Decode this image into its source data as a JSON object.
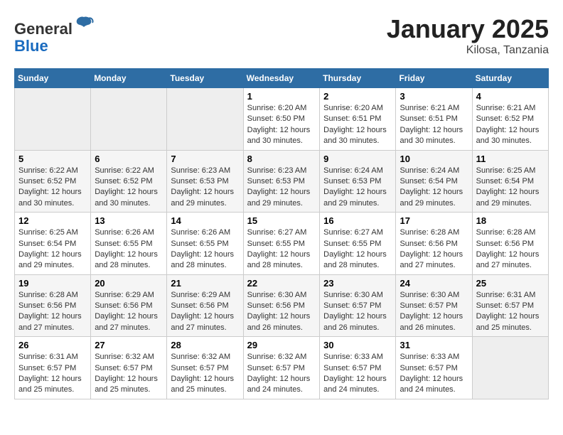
{
  "header": {
    "logo_general": "General",
    "logo_blue": "Blue",
    "month_title": "January 2025",
    "location": "Kilosa, Tanzania"
  },
  "days_of_week": [
    "Sunday",
    "Monday",
    "Tuesday",
    "Wednesday",
    "Thursday",
    "Friday",
    "Saturday"
  ],
  "weeks": [
    [
      {
        "num": "",
        "info": ""
      },
      {
        "num": "",
        "info": ""
      },
      {
        "num": "",
        "info": ""
      },
      {
        "num": "1",
        "info": "Sunrise: 6:20 AM\nSunset: 6:50 PM\nDaylight: 12 hours\nand 30 minutes."
      },
      {
        "num": "2",
        "info": "Sunrise: 6:20 AM\nSunset: 6:51 PM\nDaylight: 12 hours\nand 30 minutes."
      },
      {
        "num": "3",
        "info": "Sunrise: 6:21 AM\nSunset: 6:51 PM\nDaylight: 12 hours\nand 30 minutes."
      },
      {
        "num": "4",
        "info": "Sunrise: 6:21 AM\nSunset: 6:52 PM\nDaylight: 12 hours\nand 30 minutes."
      }
    ],
    [
      {
        "num": "5",
        "info": "Sunrise: 6:22 AM\nSunset: 6:52 PM\nDaylight: 12 hours\nand 30 minutes."
      },
      {
        "num": "6",
        "info": "Sunrise: 6:22 AM\nSunset: 6:52 PM\nDaylight: 12 hours\nand 30 minutes."
      },
      {
        "num": "7",
        "info": "Sunrise: 6:23 AM\nSunset: 6:53 PM\nDaylight: 12 hours\nand 29 minutes."
      },
      {
        "num": "8",
        "info": "Sunrise: 6:23 AM\nSunset: 6:53 PM\nDaylight: 12 hours\nand 29 minutes."
      },
      {
        "num": "9",
        "info": "Sunrise: 6:24 AM\nSunset: 6:53 PM\nDaylight: 12 hours\nand 29 minutes."
      },
      {
        "num": "10",
        "info": "Sunrise: 6:24 AM\nSunset: 6:54 PM\nDaylight: 12 hours\nand 29 minutes."
      },
      {
        "num": "11",
        "info": "Sunrise: 6:25 AM\nSunset: 6:54 PM\nDaylight: 12 hours\nand 29 minutes."
      }
    ],
    [
      {
        "num": "12",
        "info": "Sunrise: 6:25 AM\nSunset: 6:54 PM\nDaylight: 12 hours\nand 29 minutes."
      },
      {
        "num": "13",
        "info": "Sunrise: 6:26 AM\nSunset: 6:55 PM\nDaylight: 12 hours\nand 28 minutes."
      },
      {
        "num": "14",
        "info": "Sunrise: 6:26 AM\nSunset: 6:55 PM\nDaylight: 12 hours\nand 28 minutes."
      },
      {
        "num": "15",
        "info": "Sunrise: 6:27 AM\nSunset: 6:55 PM\nDaylight: 12 hours\nand 28 minutes."
      },
      {
        "num": "16",
        "info": "Sunrise: 6:27 AM\nSunset: 6:55 PM\nDaylight: 12 hours\nand 28 minutes."
      },
      {
        "num": "17",
        "info": "Sunrise: 6:28 AM\nSunset: 6:56 PM\nDaylight: 12 hours\nand 27 minutes."
      },
      {
        "num": "18",
        "info": "Sunrise: 6:28 AM\nSunset: 6:56 PM\nDaylight: 12 hours\nand 27 minutes."
      }
    ],
    [
      {
        "num": "19",
        "info": "Sunrise: 6:28 AM\nSunset: 6:56 PM\nDaylight: 12 hours\nand 27 minutes."
      },
      {
        "num": "20",
        "info": "Sunrise: 6:29 AM\nSunset: 6:56 PM\nDaylight: 12 hours\nand 27 minutes."
      },
      {
        "num": "21",
        "info": "Sunrise: 6:29 AM\nSunset: 6:56 PM\nDaylight: 12 hours\nand 27 minutes."
      },
      {
        "num": "22",
        "info": "Sunrise: 6:30 AM\nSunset: 6:56 PM\nDaylight: 12 hours\nand 26 minutes."
      },
      {
        "num": "23",
        "info": "Sunrise: 6:30 AM\nSunset: 6:57 PM\nDaylight: 12 hours\nand 26 minutes."
      },
      {
        "num": "24",
        "info": "Sunrise: 6:30 AM\nSunset: 6:57 PM\nDaylight: 12 hours\nand 26 minutes."
      },
      {
        "num": "25",
        "info": "Sunrise: 6:31 AM\nSunset: 6:57 PM\nDaylight: 12 hours\nand 25 minutes."
      }
    ],
    [
      {
        "num": "26",
        "info": "Sunrise: 6:31 AM\nSunset: 6:57 PM\nDaylight: 12 hours\nand 25 minutes."
      },
      {
        "num": "27",
        "info": "Sunrise: 6:32 AM\nSunset: 6:57 PM\nDaylight: 12 hours\nand 25 minutes."
      },
      {
        "num": "28",
        "info": "Sunrise: 6:32 AM\nSunset: 6:57 PM\nDaylight: 12 hours\nand 25 minutes."
      },
      {
        "num": "29",
        "info": "Sunrise: 6:32 AM\nSunset: 6:57 PM\nDaylight: 12 hours\nand 24 minutes."
      },
      {
        "num": "30",
        "info": "Sunrise: 6:33 AM\nSunset: 6:57 PM\nDaylight: 12 hours\nand 24 minutes."
      },
      {
        "num": "31",
        "info": "Sunrise: 6:33 AM\nSunset: 6:57 PM\nDaylight: 12 hours\nand 24 minutes."
      },
      {
        "num": "",
        "info": ""
      }
    ]
  ]
}
